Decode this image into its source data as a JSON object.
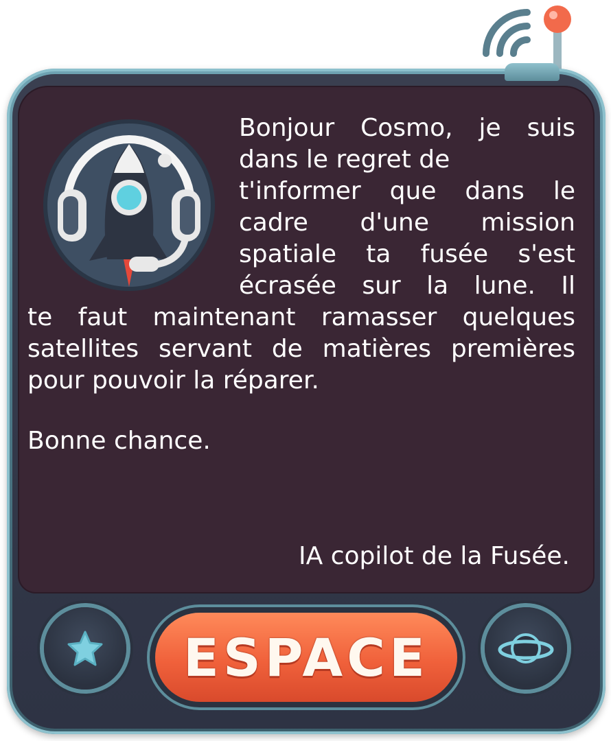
{
  "message": {
    "top_lines": [
      "Bonjour Cosmo, je suis",
      "dans le regret de",
      "t'informer que dans le",
      "cadre d'une mission",
      "spatiale ta fusée s'est",
      "écrasée sur la lune. Il"
    ],
    "full_lines": [
      "te faut maintenant ramasser quelques",
      "satellites servant de matières premières",
      "pour pouvoir la réparer."
    ],
    "wish": "Bonne chance.",
    "signature": "IA copilot de la Fusée."
  },
  "buttons": {
    "space_label": "ESPACE",
    "left_icon": "star-icon",
    "right_icon": "planet-icon"
  },
  "colors": {
    "screen": "#3a2634",
    "frame": "#5d8e9c",
    "accent": "#f0613b",
    "text": "#ffffff"
  }
}
